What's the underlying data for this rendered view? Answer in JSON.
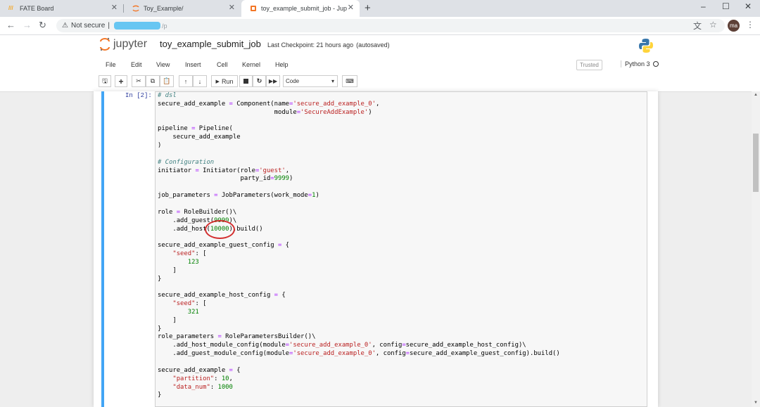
{
  "browser": {
    "tabs": [
      {
        "title": "FATE Board",
        "icon": "fate-icon"
      },
      {
        "title": "Toy_Example/",
        "icon": "jupyter-icon"
      },
      {
        "title": "toy_example_submit_job - Jup",
        "icon": "jupyter-notebook-icon"
      }
    ],
    "active_tab": 2,
    "new_tab": "+",
    "address": {
      "security": "Not secure",
      "separator": "|",
      "url_tail": "/p"
    },
    "profile_initials": "ma",
    "window_controls": {
      "minimize": "–",
      "maximize": "☐",
      "close": "✕"
    }
  },
  "jupyter": {
    "logo_text": "jupyter",
    "notebook_name": "toy_example_submit_job",
    "checkpoint": "Last Checkpoint: 21 hours ago",
    "autosave": "(autosaved)",
    "menu": [
      "File",
      "Edit",
      "View",
      "Insert",
      "Cell",
      "Kernel",
      "Help"
    ],
    "trusted": "Trusted",
    "kernel": "Python 3",
    "toolbar": {
      "run_label": "Run",
      "cell_type": "Code"
    }
  },
  "cell": {
    "prompt": "In [2]:",
    "highlighted_value": "10000"
  },
  "colors": {
    "accent": "#42a5f5",
    "annotation": "#d32f2f",
    "comment": "#408080",
    "string": "#ba2121",
    "number": "#008000"
  }
}
